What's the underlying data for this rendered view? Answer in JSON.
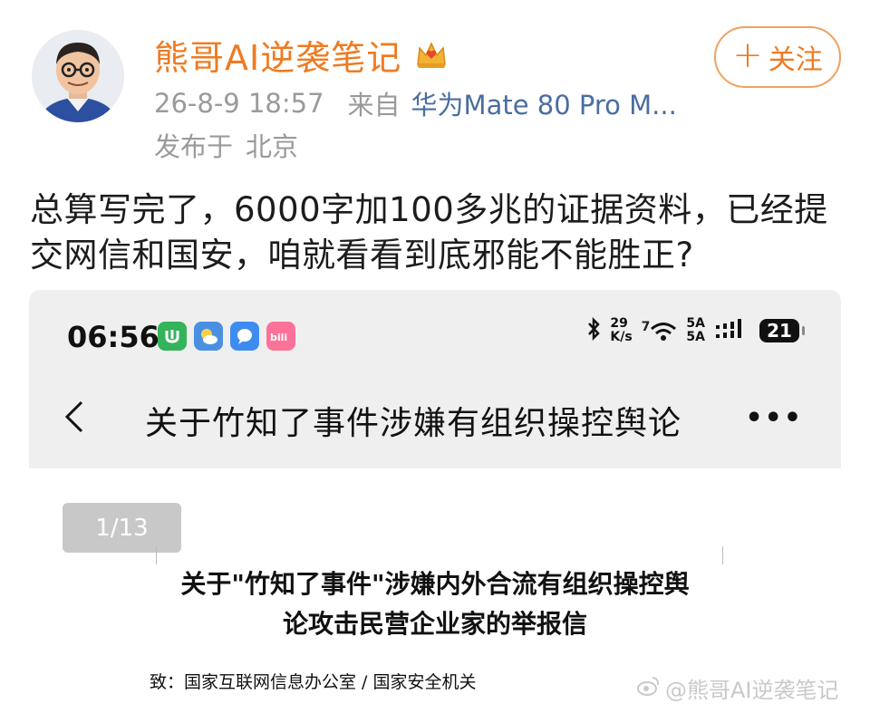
{
  "post": {
    "username": "熊哥AI逆袭笔记",
    "follow_label": "关注",
    "timestamp": "26-8-9 18:57",
    "source_prefix": "来自",
    "device": "华为Mate 80 Pro M...",
    "location_prefix": "发布于",
    "location": "北京",
    "text": "总算写完了，6000字加100多兆的证据资料，已经提交网信和国安，咱就看看到底邪能不能胜正?"
  },
  "embedded_screenshot": {
    "status_bar": {
      "time": "06:56",
      "net_speed_value": "29",
      "net_speed_unit": "K/s",
      "wifi_label": "7",
      "signal_label_1": "5A",
      "signal_label_2": "5A",
      "battery": "21",
      "app_icons": [
        "app-green-icon",
        "weather-icon",
        "chat-bubble-icon",
        "bilibili-icon"
      ]
    },
    "nav": {
      "title": "关于竹知了事件涉嫌有组织操控舆论"
    },
    "document": {
      "page_indicator": "1/13",
      "heading_line1": "关于\"竹知了事件\"涉嫌内外合流有组织操控舆",
      "heading_line2": "论攻击民营企业家的举报信",
      "to_line": "致：国家互联网信息办公室 / 国家安全机关"
    }
  },
  "watermark": {
    "text": "@熊哥AI逆袭笔记"
  },
  "colors": {
    "accent": "#ee7b22",
    "device_link": "#4a6da0",
    "meta_gray": "#9a9a9a",
    "embed_bg": "#efefef"
  }
}
